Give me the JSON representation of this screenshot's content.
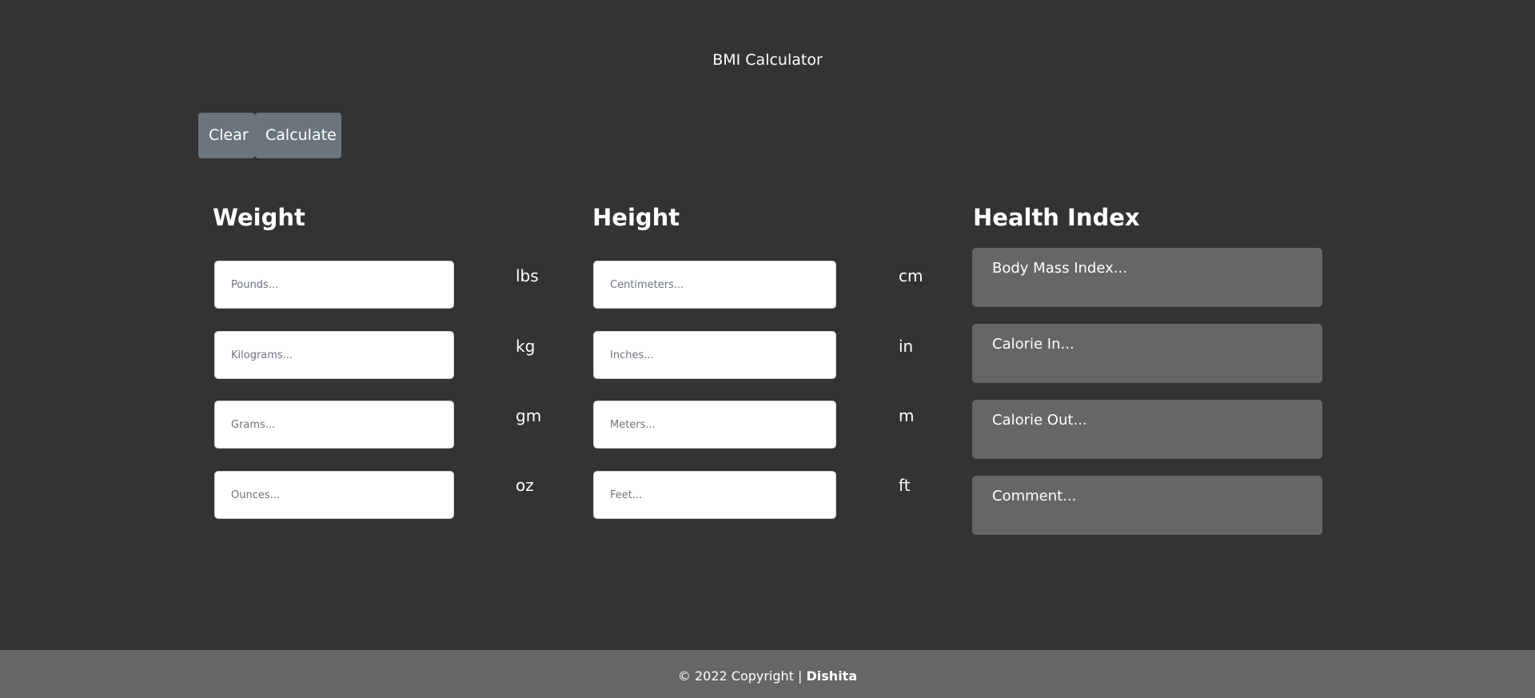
{
  "app": {
    "title": "BMI Calculator"
  },
  "toolbar": {
    "clear_label": "Clear",
    "calculate_label": "Calculate"
  },
  "weight": {
    "heading": "Weight",
    "fields": [
      {
        "placeholder": "Pounds...",
        "value": "",
        "unit": "lbs"
      },
      {
        "placeholder": "Kilograms...",
        "value": "",
        "unit": "kg"
      },
      {
        "placeholder": "Grams...",
        "value": "",
        "unit": "gm"
      },
      {
        "placeholder": "Ounces...",
        "value": "",
        "unit": "oz"
      }
    ]
  },
  "height": {
    "heading": "Height",
    "fields": [
      {
        "placeholder": "Centimeters...",
        "value": "",
        "unit": "cm"
      },
      {
        "placeholder": "Inches...",
        "value": "",
        "unit": "in"
      },
      {
        "placeholder": "Meters...",
        "value": "",
        "unit": "m"
      },
      {
        "placeholder": "Feet...",
        "value": "",
        "unit": "ft"
      }
    ]
  },
  "health": {
    "heading": "Health Index",
    "outputs": [
      {
        "text": "Body Mass Index..."
      },
      {
        "text": "Calorie In..."
      },
      {
        "text": "Calorie Out..."
      },
      {
        "text": "Comment..."
      }
    ]
  },
  "footer": {
    "copyright": "© 2022 Copyright |",
    "author": "Dishita"
  },
  "colors": {
    "background": "#333333",
    "button": "#6c757d",
    "result_box": "#666666",
    "footer": "#666666"
  }
}
